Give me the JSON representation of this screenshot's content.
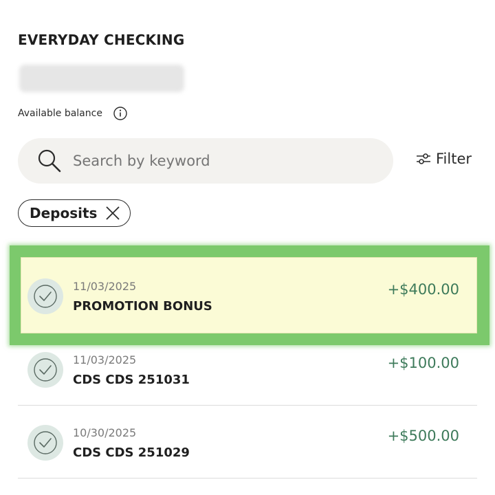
{
  "account": {
    "title": "EVERYDAY CHECKING",
    "available_label": "Available balance"
  },
  "search": {
    "placeholder": "Search by keyword"
  },
  "filter": {
    "label": "Filter"
  },
  "active_filter_chip": {
    "label": "Deposits"
  },
  "transactions": [
    {
      "date": "11/03/2025",
      "description": "PROMOTION BONUS",
      "amount": "+$400.00",
      "highlighted": true
    },
    {
      "date": "11/03/2025",
      "description": "CDS CDS 251031",
      "amount": "+$100.00",
      "highlighted": false
    },
    {
      "date": "10/30/2025",
      "description": "CDS CDS 251029",
      "amount": "+$500.00",
      "highlighted": false
    }
  ],
  "colors": {
    "amount_positive": "#3d7a5a",
    "highlight_outer": "#7cc96c",
    "highlight_inner": "#fbfbd6",
    "status_circle": "#dde8e3",
    "search_bg": "#f3f2ef"
  },
  "icons": {
    "info": "info-icon",
    "search": "search-icon",
    "filter": "sliders-icon",
    "chip_close": "close-icon",
    "status": "check-circle-icon"
  }
}
